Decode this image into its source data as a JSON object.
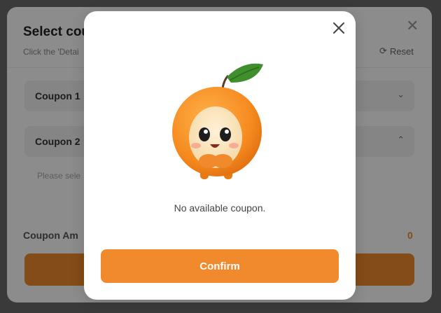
{
  "background": {
    "title": "Select cou",
    "subtitle": "Click the 'Detai",
    "reset_label": "Reset",
    "coupons": [
      {
        "label": "Coupon 1"
      },
      {
        "label": "Coupon 2"
      }
    ],
    "hint": "Please sele",
    "amount_label": "Coupon Am",
    "amount_value": "0"
  },
  "modal": {
    "message": "No available coupon.",
    "confirm_label": "Confirm"
  },
  "colors": {
    "accent": "#f08a2c",
    "leaf": "#3f8f2f"
  }
}
